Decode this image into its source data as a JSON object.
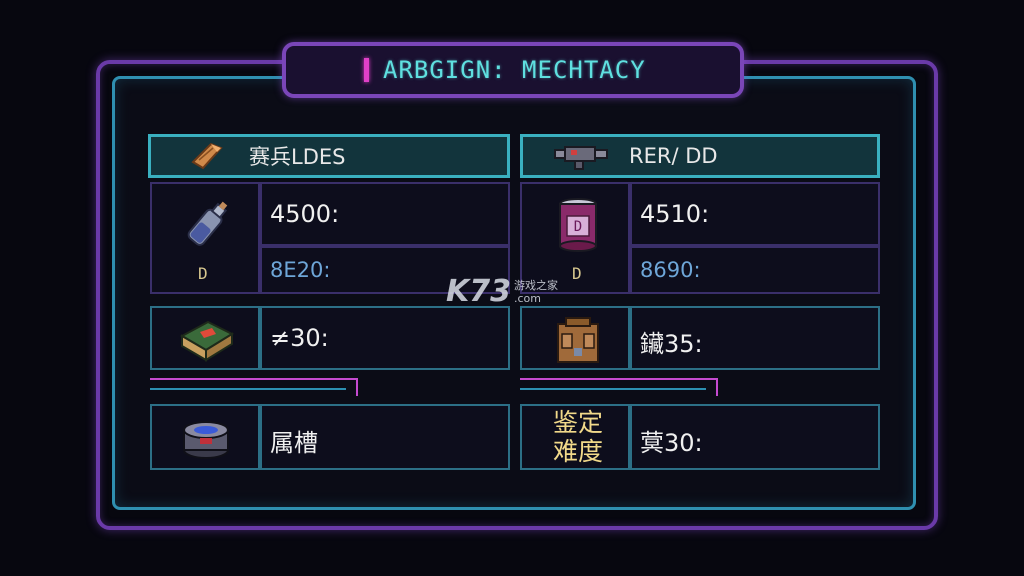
{
  "window": {
    "title": "ARBGIGN: MECHTACY"
  },
  "left_panel": {
    "header": "赛兵LDES",
    "rows": [
      {
        "icon": "potion-bottle-icon",
        "grade": "D",
        "value": "4500:",
        "sub_value": "8E20:"
      },
      {
        "icon": "spellbook-icon",
        "value": "≠30:"
      },
      {
        "icon": "gem-canister-icon",
        "value": "属槽"
      }
    ]
  },
  "right_panel": {
    "header": "RER/ DD",
    "rows": [
      {
        "icon": "purple-jar-icon",
        "grade": "D",
        "value": "4510:",
        "sub_value": "8690:"
      },
      {
        "icon": "leather-pack-icon",
        "value": "鑶35:"
      },
      {
        "label_lines": [
          "鉴定",
          "难度"
        ],
        "value": "蓂30:"
      }
    ]
  },
  "watermark": {
    "brand": "K73",
    "cn": "游戏之家",
    "domain": ".com"
  },
  "colors": {
    "background": "#07070f",
    "outer_frame": "#6a3aa8",
    "inner_frame": "#2f8fb0",
    "title_text": "#5fe0e0",
    "accent_pink": "#e040c8",
    "label_gold": "#f1d98a"
  }
}
